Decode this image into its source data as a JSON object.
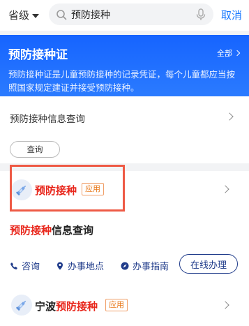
{
  "header": {
    "region_label": "省级",
    "search_value": "预防接种",
    "cancel_label": "取消"
  },
  "service_card": {
    "title": "预防接种证",
    "all_label": "全部",
    "description": "预防接种证是儿童预防接种的记录凭证，每个儿童都应当按照国家规定建证并接受预防接种。"
  },
  "info_query": {
    "label": "预防接种信息查询",
    "button_label": "查询"
  },
  "app_result": {
    "name": "预防接种",
    "tag": "应用",
    "subtitle_highlight": "预防接种",
    "subtitle_rest": "信息查询",
    "actions": {
      "consult": "咨询",
      "location": "办事地点",
      "guide": "办事指南",
      "online": "在线办理"
    }
  },
  "bottom_result": {
    "prefix": "宁波",
    "highlight": "预防接种",
    "tag": "应用"
  },
  "colors": {
    "accent_blue": "#1677ff",
    "card_blue": "#1664ff",
    "highlight_red": "#e8251a",
    "box_red": "#ee5a45",
    "action_navy": "#1f3b8a"
  }
}
